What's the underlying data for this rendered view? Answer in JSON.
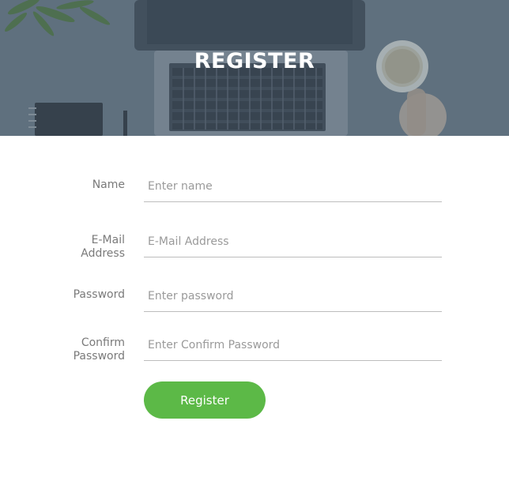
{
  "header": {
    "title": "REGISTER"
  },
  "form": {
    "fields": [
      {
        "label_lines": [
          "Name"
        ],
        "placeholder": "Enter name"
      },
      {
        "label_lines": [
          "E-Mail",
          "Address"
        ],
        "placeholder": "E-Mail Address"
      },
      {
        "label_lines": [
          "Password"
        ],
        "placeholder": "Enter password"
      },
      {
        "label_lines": [
          "Confirm",
          "Password"
        ],
        "placeholder": "Enter Confirm Password"
      }
    ],
    "submit_label": "Register"
  },
  "colors": {
    "accent": "#5cb947",
    "label_text": "#7a7a7a",
    "placeholder_text": "#9a9a9a",
    "underline": "#bdbdbd",
    "hero_overlay": "#4a5c6c"
  },
  "icons": [
    "laptop-illustration",
    "plant-illustration",
    "coffee-cup-illustration",
    "notebook-illustration"
  ]
}
